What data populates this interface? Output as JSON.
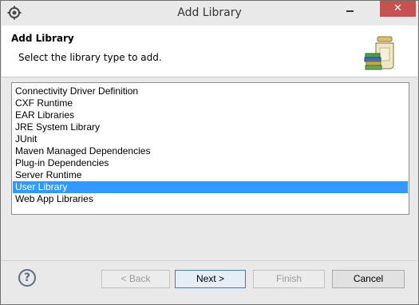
{
  "window": {
    "title": "Add Library",
    "close_label": "✕",
    "accent": "#c75050"
  },
  "header": {
    "title": "Add Library",
    "description": "Select the library type to add."
  },
  "library_types": {
    "items": [
      "Connectivity Driver Definition",
      "CXF Runtime",
      "EAR Libraries",
      "JRE System Library",
      "JUnit",
      "Maven Managed Dependencies",
      "Plug-in Dependencies",
      "Server Runtime",
      "User Library",
      "Web App Libraries"
    ],
    "selected": "User Library",
    "selection_color": "#3399ff"
  },
  "footer": {
    "help_glyph": "?",
    "back_label": "< Back",
    "next_label": "Next >",
    "finish_label": "Finish",
    "cancel_label": "Cancel"
  },
  "icons": [
    "eclipse-app-icon",
    "minimize-icon",
    "close-icon",
    "library-jar-icon",
    "help-icon"
  ]
}
